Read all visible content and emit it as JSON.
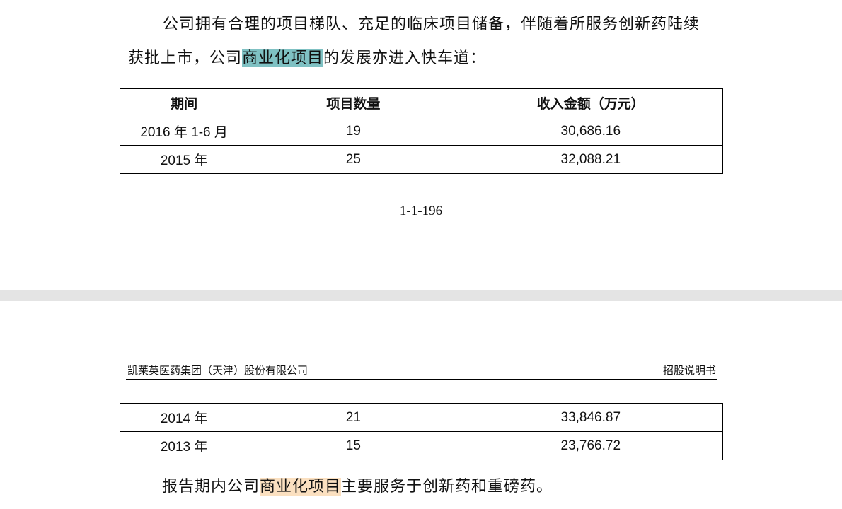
{
  "page1": {
    "para_line1": "公司拥有合理的项目梯队、充足的临床项目储备，伴随着所服务创新药陆续",
    "para_line2_pre": "获批上市，公司",
    "para_line2_hl": "商业化项目",
    "para_line2_post": "的发展亦进入快车道：",
    "table": {
      "headers": [
        "期间",
        "项目数量",
        "收入金额（万元）"
      ],
      "rows": [
        [
          "2016 年 1-6 月",
          "19",
          "30,686.16"
        ],
        [
          "2015 年",
          "25",
          "32,088.21"
        ]
      ]
    },
    "page_number": "1-1-196"
  },
  "page2": {
    "header_left": "凯莱英医药集团（天津）股份有限公司",
    "header_right": "招股说明书",
    "table": {
      "rows": [
        [
          "2014 年",
          "21",
          "33,846.87"
        ],
        [
          "2013 年",
          "15",
          "23,766.72"
        ]
      ]
    },
    "para_pre": "报告期内公司",
    "para_hl": "商业化项目",
    "para_post": "主要服务于创新药和重磅药。"
  },
  "colors": {
    "highlight_teal": "#7fc1c3",
    "highlight_peach": "#fbe0c0",
    "page_gap": "#e4e4e4"
  }
}
